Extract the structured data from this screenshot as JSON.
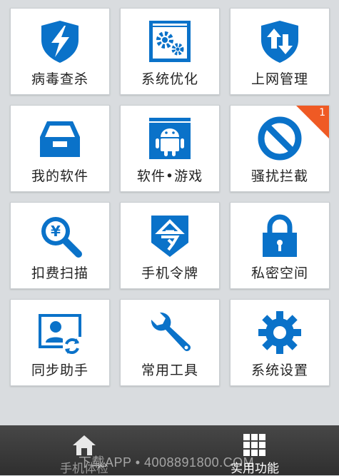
{
  "tiles": [
    {
      "label": "病毒查杀",
      "icon": "shield-bolt-icon"
    },
    {
      "label": "系统优化",
      "icon": "gears-icon"
    },
    {
      "label": "上网管理",
      "icon": "shield-arrows-icon"
    },
    {
      "label": "我的软件",
      "icon": "inbox-tray-icon"
    },
    {
      "label": "软件•游戏",
      "icon": "android-icon"
    },
    {
      "label": "骚扰拦截",
      "icon": "block-icon",
      "badge": "1"
    },
    {
      "label": "扣费扫描",
      "icon": "yen-search-icon"
    },
    {
      "label": "手机令牌",
      "icon": "token-shield-icon"
    },
    {
      "label": "私密空间",
      "icon": "lock-icon"
    },
    {
      "label": "同步助手",
      "icon": "contact-sync-icon"
    },
    {
      "label": "常用工具",
      "icon": "wrench-icon"
    },
    {
      "label": "系统设置",
      "icon": "gear-icon"
    }
  ],
  "nav": {
    "checkup": {
      "label": "手机体检",
      "icon": "home-icon"
    },
    "tools": {
      "label": "实用功能",
      "icon": "grid-icon"
    }
  },
  "watermark": "下载APP • 4008891800.COM",
  "colors": {
    "accent": "#0a72c9",
    "badge": "#ef5a24"
  }
}
